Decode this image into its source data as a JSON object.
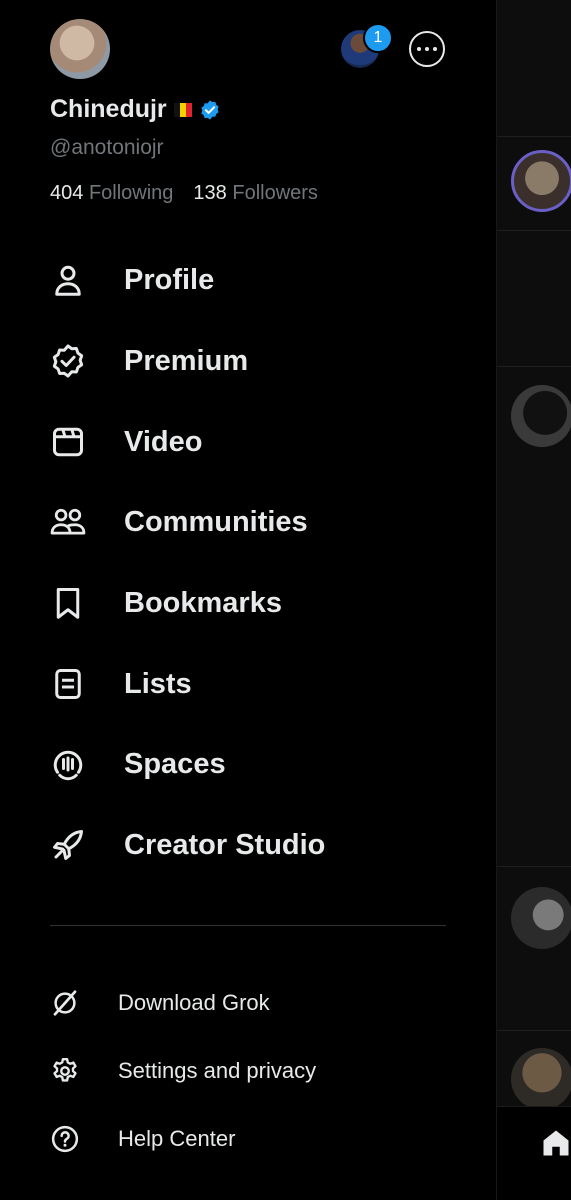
{
  "profile": {
    "name": "Chinedujr",
    "handle": "@anotoniojr",
    "following_count": "404",
    "following_label": "Following",
    "followers_count": "138",
    "followers_label": "Followers",
    "notification_badge": "1"
  },
  "menu": [
    {
      "label": "Profile",
      "icon": "person-icon"
    },
    {
      "label": "Premium",
      "icon": "verified-badge-icon"
    },
    {
      "label": "Video",
      "icon": "video-icon"
    },
    {
      "label": "Communities",
      "icon": "communities-icon"
    },
    {
      "label": "Bookmarks",
      "icon": "bookmark-icon"
    },
    {
      "label": "Lists",
      "icon": "list-icon"
    },
    {
      "label": "Spaces",
      "icon": "spaces-icon"
    },
    {
      "label": "Creator Studio",
      "icon": "rocket-icon"
    }
  ],
  "secondary": [
    {
      "label": "Download Grok",
      "icon": "grok-icon"
    },
    {
      "label": "Settings and privacy",
      "icon": "gear-icon"
    },
    {
      "label": "Help Center",
      "icon": "help-icon"
    }
  ],
  "colors": {
    "background": "#000000",
    "text": "#e7e9ea",
    "muted": "#71767b",
    "accent": "#1d9bf0"
  }
}
